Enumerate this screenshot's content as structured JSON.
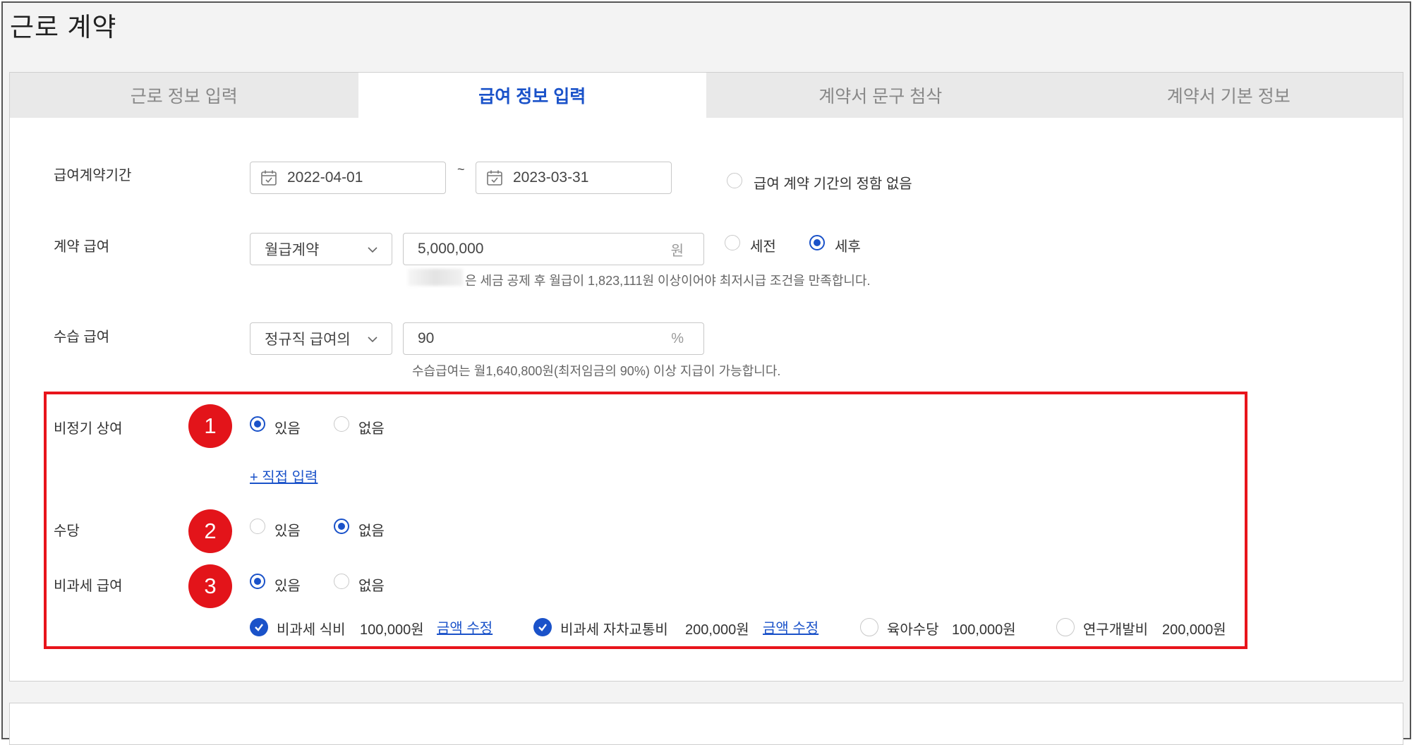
{
  "page": {
    "title": "근로 계약"
  },
  "tabs": [
    {
      "label": "근로 정보 입력",
      "active": false
    },
    {
      "label": "급여 정보 입력",
      "active": true
    },
    {
      "label": "계약서 문구 첨삭",
      "active": false
    },
    {
      "label": "계약서 기본 정보",
      "active": false
    }
  ],
  "period": {
    "label": "급여계약기간",
    "start": "2022-04-01",
    "separator": "~",
    "end": "2023-03-31",
    "no_period_label": "급여 계약 기간의 정함 없음",
    "no_period_selected": false
  },
  "salary": {
    "label": "계약 급여",
    "type_value": "월급계약",
    "amount": "5,000,000",
    "unit": "원",
    "pretax_label": "세전",
    "posttax_label": "세후",
    "selected": "세후",
    "hint": "은 세금 공제 후 월급이 1,823,111원 이상이어야 최저시급 조건을 만족합니다."
  },
  "probation": {
    "label": "수습 급여",
    "type_value": "정규직 급여의",
    "percent": "90",
    "unit": "%",
    "hint": "수습급여는 월1,640,800원(최저임금의 90%) 이상 지급이 가능합니다."
  },
  "bonus": {
    "label": "비정기 상여",
    "badge": "1",
    "yes_label": "있음",
    "no_label": "없음",
    "selected": "있음",
    "direct_input": "+ 직접 입력"
  },
  "allowance": {
    "label": "수당",
    "badge": "2",
    "yes_label": "있음",
    "no_label": "없음",
    "selected": "없음"
  },
  "nontax": {
    "label": "비과세 급여",
    "badge": "3",
    "yes_label": "있음",
    "no_label": "없음",
    "selected": "있음",
    "items": [
      {
        "name": "비과세 식비",
        "amount": "100,000원",
        "checked": true,
        "edit": "금액 수정"
      },
      {
        "name": "비과세 자차교통비",
        "amount": "200,000원",
        "checked": true,
        "edit": "금액 수정"
      },
      {
        "name": "육아수당",
        "amount": "100,000원",
        "checked": false
      },
      {
        "name": "연구개발비",
        "amount": "200,000원",
        "checked": false
      }
    ]
  },
  "colors": {
    "accent": "#1a52c9",
    "highlight": "#e8141b"
  },
  "icons": {
    "date": "calendar-icon",
    "dropdown": "chevron-down-icon",
    "check": "check-icon"
  }
}
